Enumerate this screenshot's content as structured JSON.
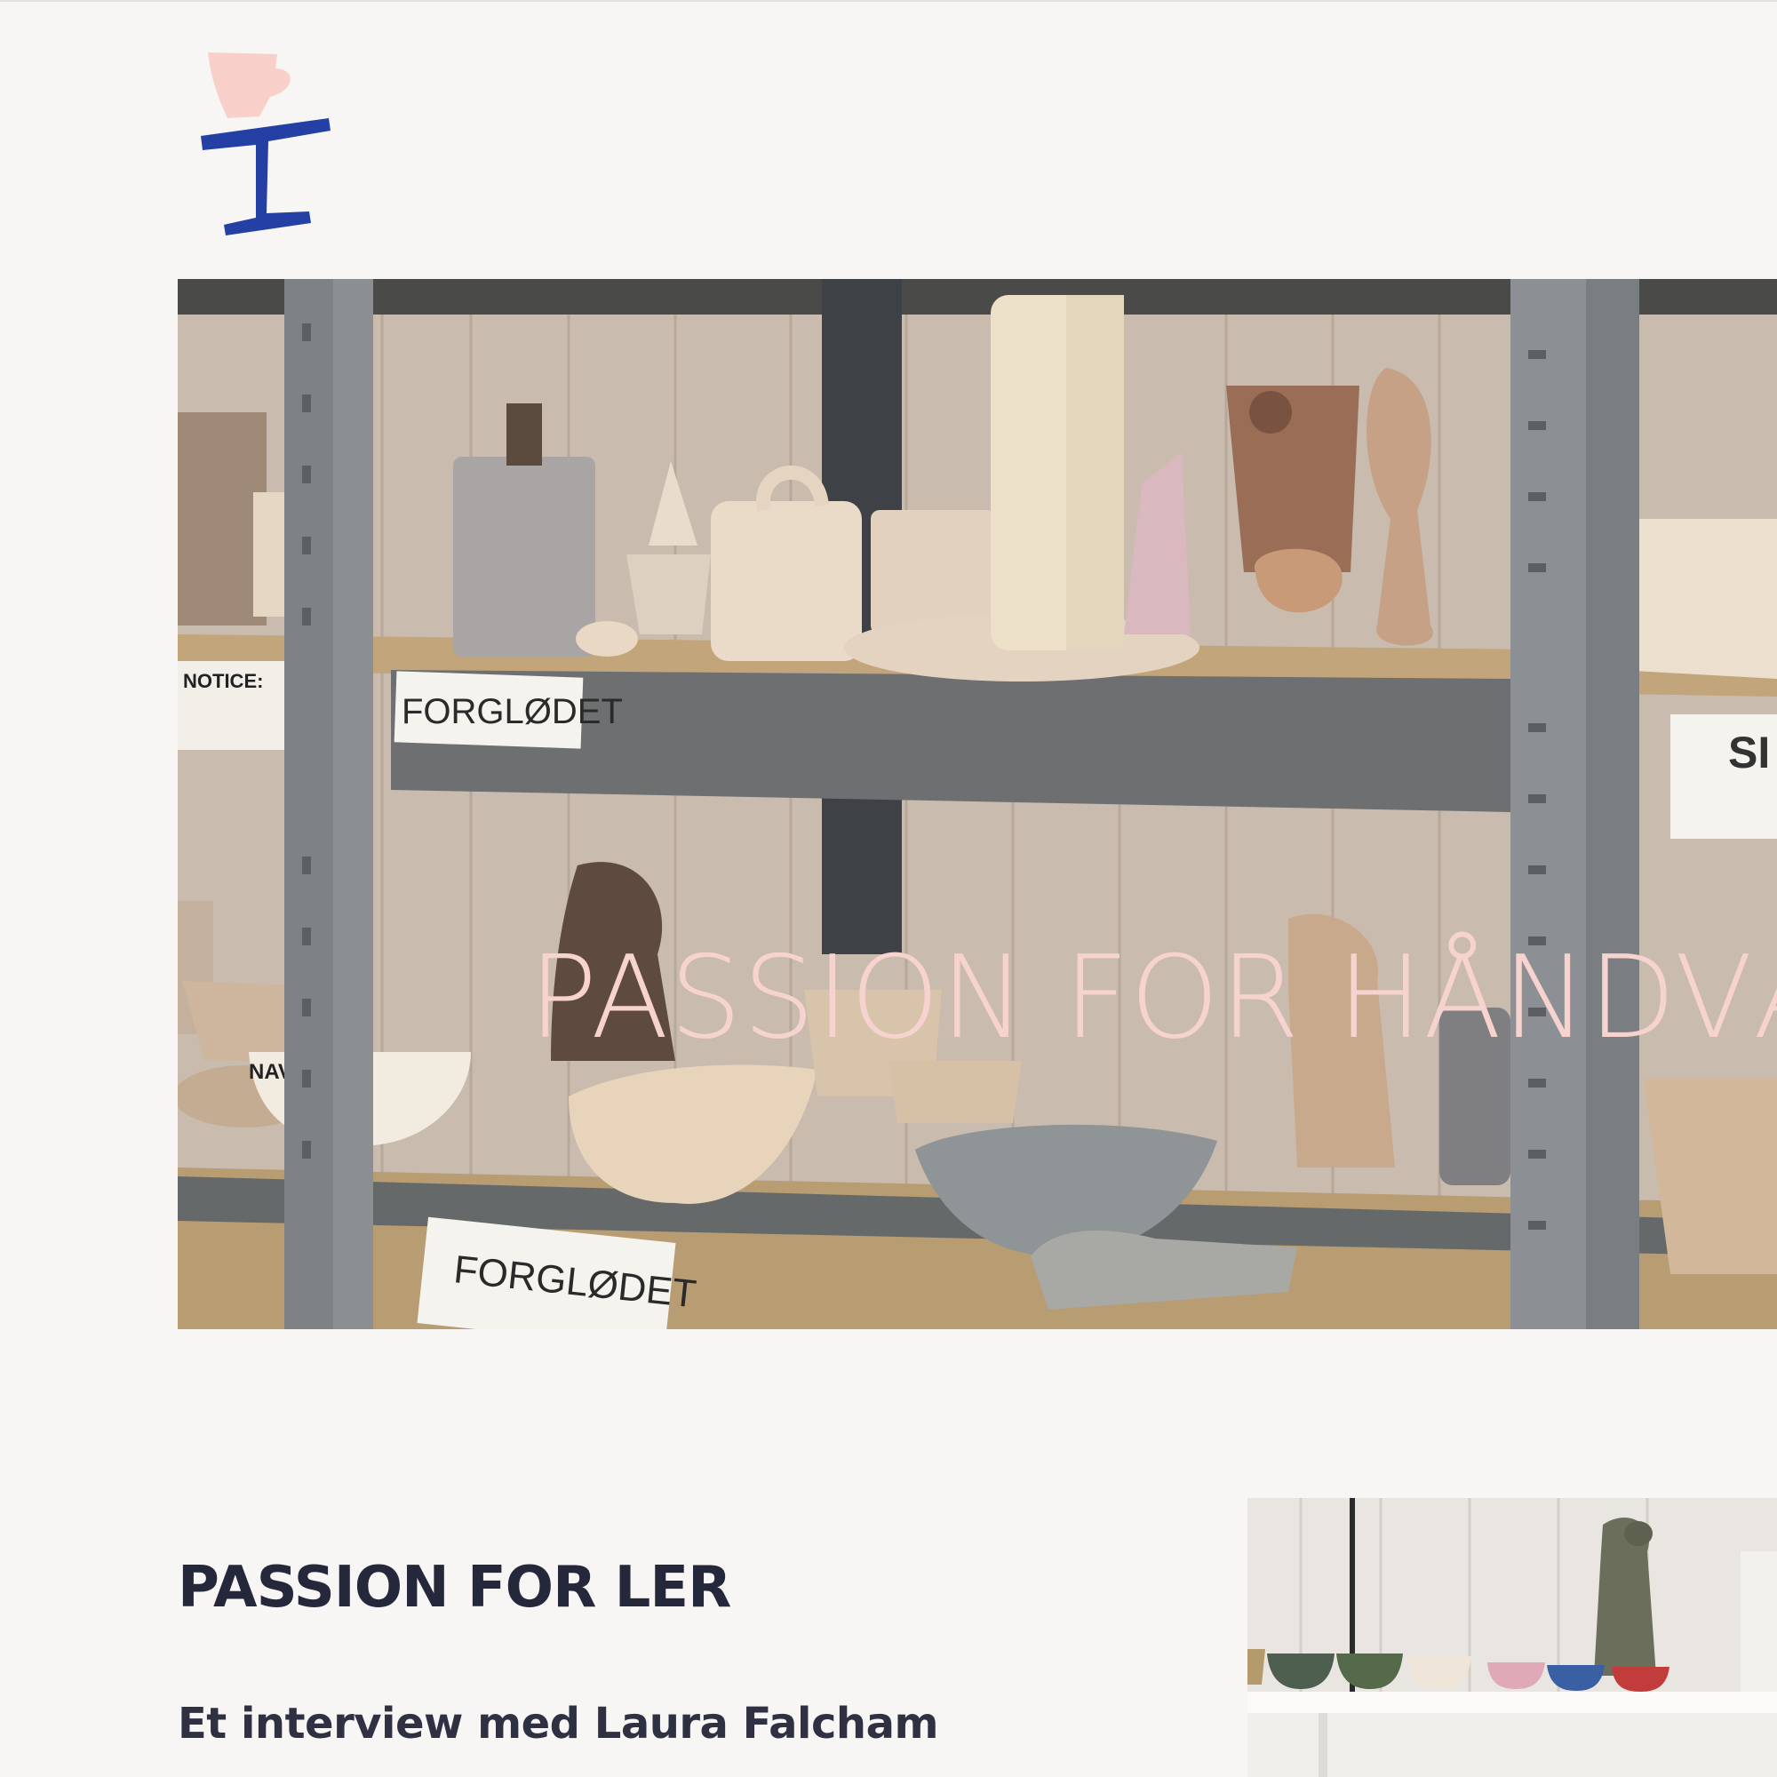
{
  "site": {
    "logo": "cup-on-stand-logo"
  },
  "hero": {
    "title": "PASSION FOR HÅNDVÆRK",
    "shelf_label_top": "FORGLØDET",
    "shelf_label_bottom": "FORGLØDET",
    "notice_label": "NOTICE:",
    "bowl_label": "NAVN PÅ",
    "side_label": "SI BE"
  },
  "article": {
    "title": "PASSION FOR LER",
    "subtitle": "Et interview med Laura Falcham"
  },
  "colors": {
    "background": "#f7f6f4",
    "hero_title": "#f6d3cf",
    "logo_pink": "#f8cfc9",
    "logo_blue": "#2440a5",
    "heading": "#25273a"
  }
}
